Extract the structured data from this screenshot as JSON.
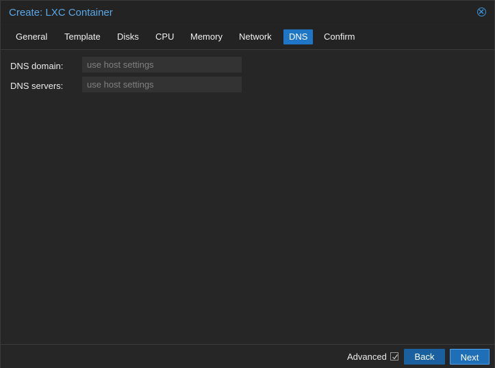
{
  "window": {
    "title": "Create: LXC Container"
  },
  "tabs": [
    {
      "label": "General"
    },
    {
      "label": "Template"
    },
    {
      "label": "Disks"
    },
    {
      "label": "CPU"
    },
    {
      "label": "Memory"
    },
    {
      "label": "Network"
    },
    {
      "label": "DNS",
      "active": true
    },
    {
      "label": "Confirm"
    }
  ],
  "form": {
    "dns_domain": {
      "label": "DNS domain:",
      "placeholder": "use host settings",
      "value": ""
    },
    "dns_servers": {
      "label": "DNS servers:",
      "placeholder": "use host settings",
      "value": ""
    }
  },
  "footer": {
    "advanced_label": "Advanced",
    "advanced_checked": true,
    "back_label": "Back",
    "next_label": "Next"
  },
  "colors": {
    "accent": "#1f76c7",
    "title": "#5aa9ea",
    "background": "#262626"
  },
  "icons": {
    "close": "close-circle-icon",
    "checkbox": "checkbox-checked-icon"
  }
}
